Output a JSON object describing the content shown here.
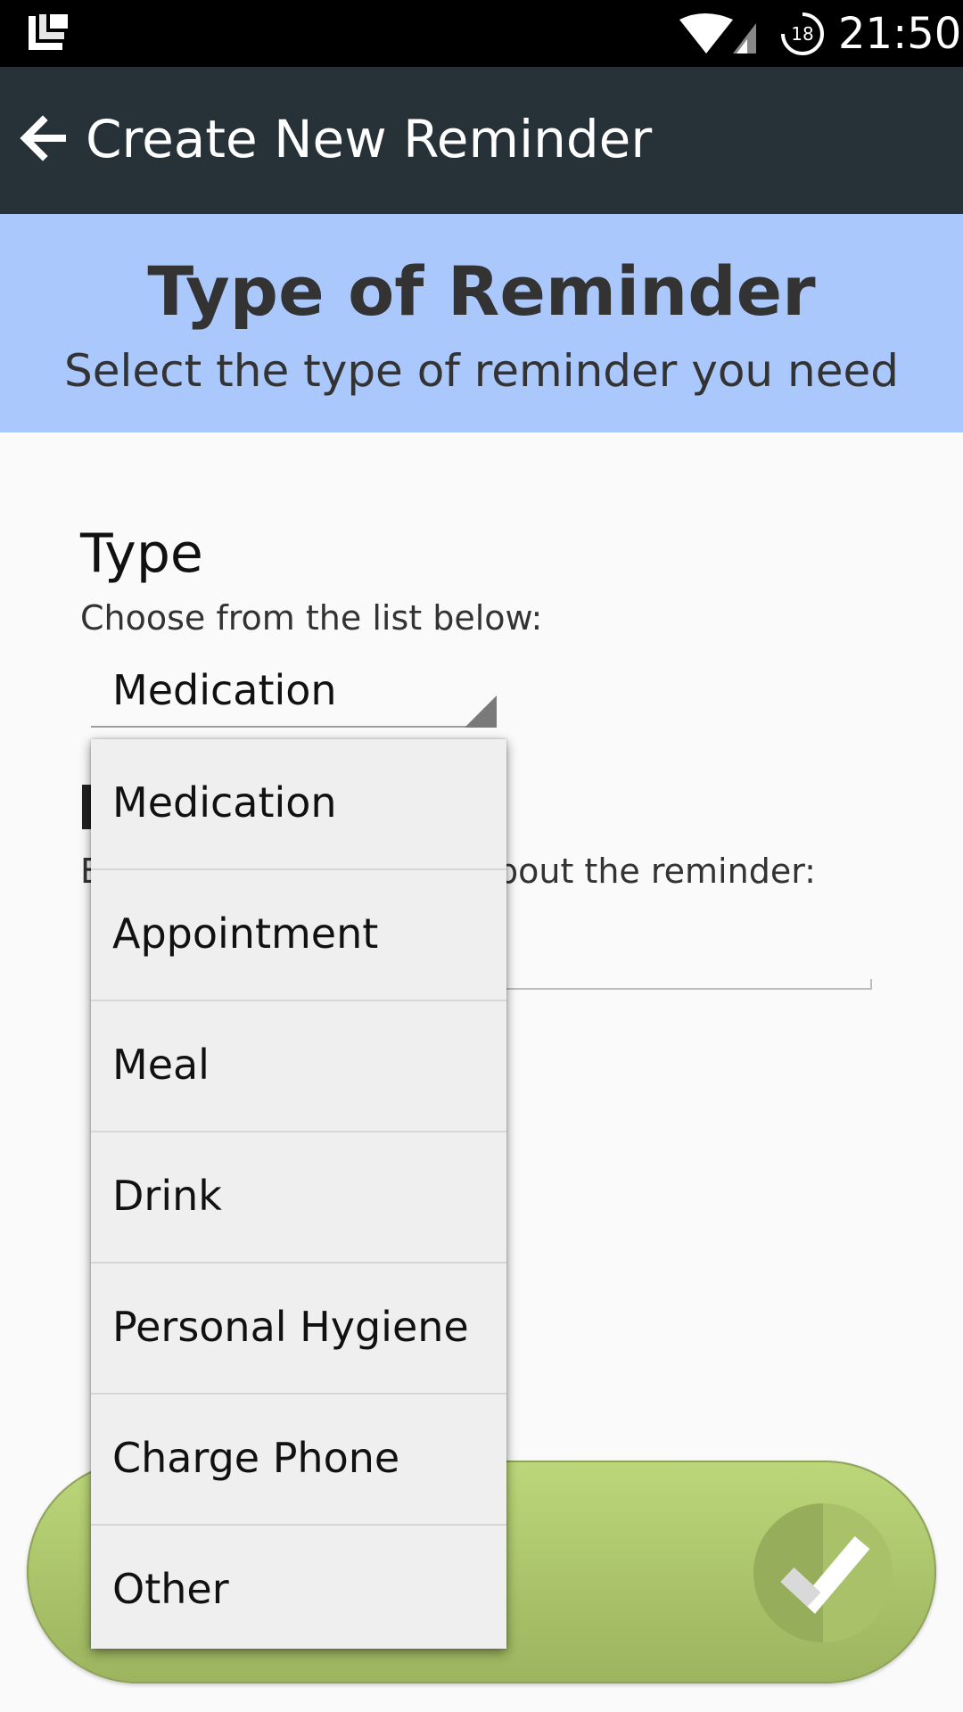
{
  "status_bar": {
    "time": "21:50",
    "sync_badge": "18",
    "icons": [
      "app-launcher-icon",
      "wifi-icon",
      "signal-icon",
      "sync-icon"
    ]
  },
  "toolbar": {
    "title": "Create New Reminder",
    "back_icon": "arrow-left-icon"
  },
  "banner": {
    "title": "Type of Reminder",
    "subtitle": "Select the type of reminder you need"
  },
  "type_section": {
    "title": "Type",
    "hint": "Choose from the list below:",
    "selected": "Medication"
  },
  "details_section": {
    "hint_visible": "bout the reminder:"
  },
  "dropdown": {
    "options": [
      {
        "label": "Medication"
      },
      {
        "label": "Appointment"
      },
      {
        "label": "Meal"
      },
      {
        "label": "Drink"
      },
      {
        "label": "Personal Hygiene"
      },
      {
        "label": "Charge Phone"
      },
      {
        "label": "Other"
      }
    ]
  },
  "confirm": {
    "icon": "checkmark-icon"
  },
  "colors": {
    "status_bar": "#000000",
    "toolbar": "#263238",
    "banner": "#aac8fc",
    "background": "#fafafa",
    "dropdown_bg": "#efefef",
    "confirm_green_light": "#bcd77a",
    "confirm_green_dark": "#9cb45e"
  }
}
